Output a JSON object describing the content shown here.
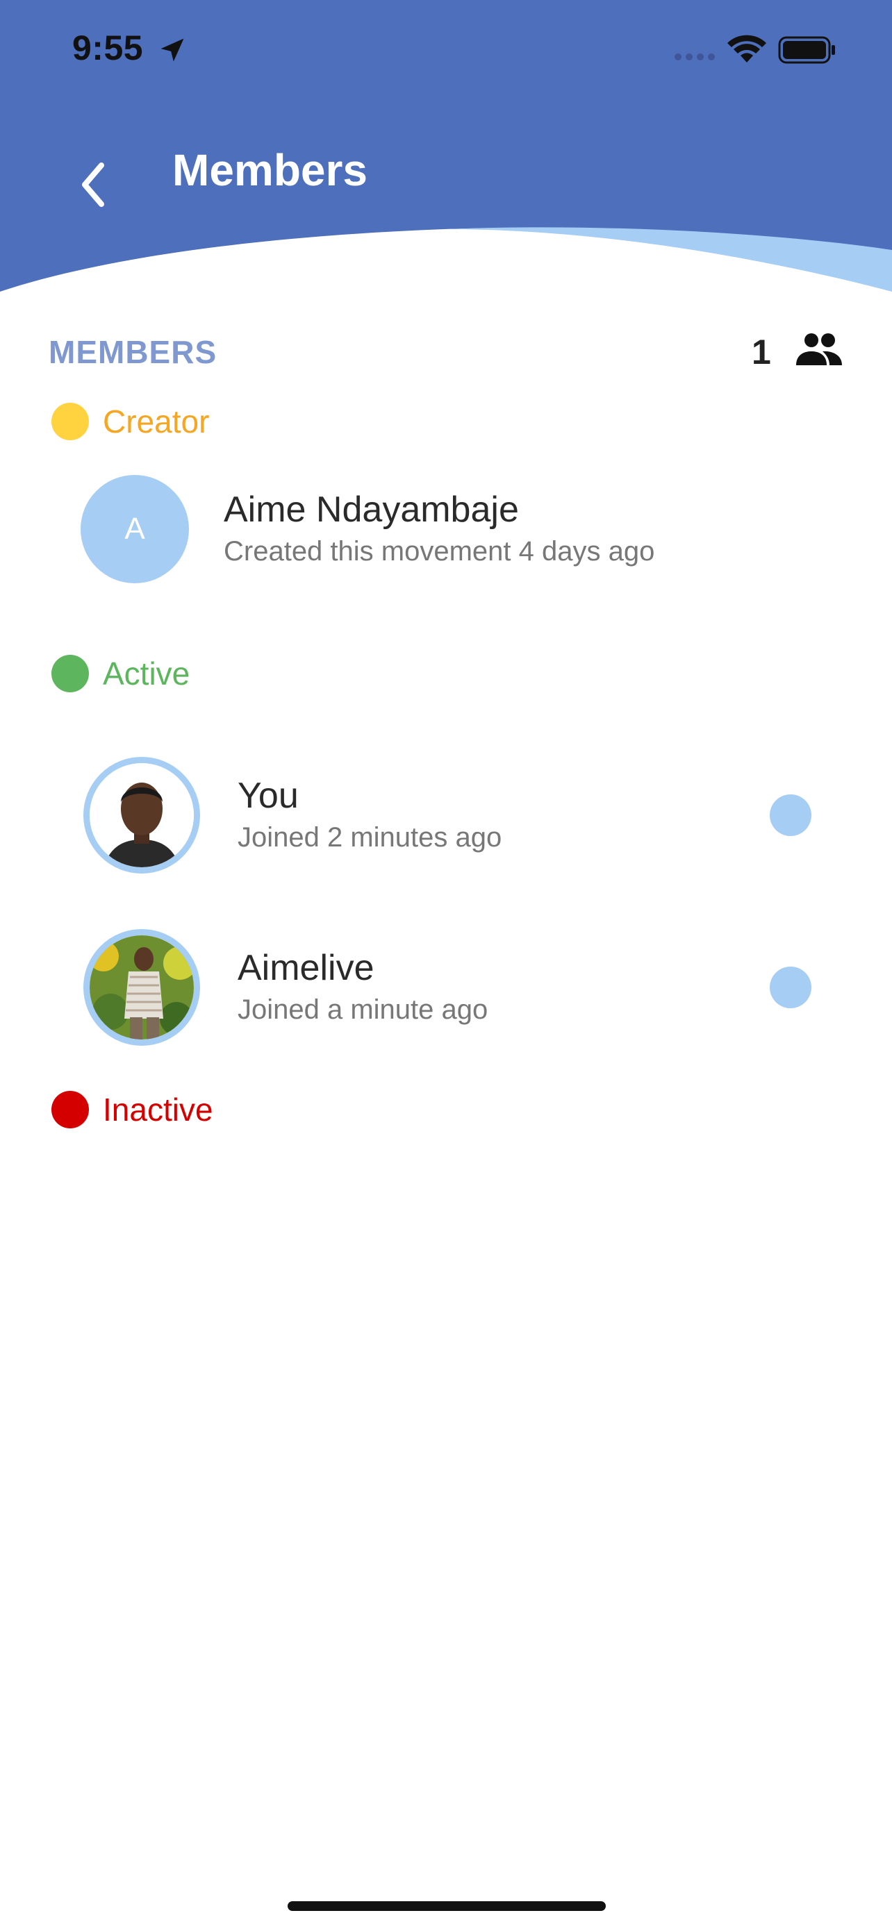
{
  "status_bar": {
    "time": "9:55"
  },
  "header": {
    "title": "Members",
    "bg_color": "#4E6FBC",
    "wave_color": "#A6CDF4"
  },
  "members_section": {
    "label": "MEMBERS",
    "count": "1"
  },
  "categories": {
    "creator": {
      "label": "Creator",
      "color": "#F5A623",
      "dot_color": "#FFD23F"
    },
    "active": {
      "label": "Active",
      "color": "#5DB55E",
      "dot_color": "#5DB55E"
    },
    "inactive": {
      "label": "Inactive",
      "color": "#D40000",
      "dot_color": "#D40000"
    }
  },
  "creator_member": {
    "initial": "A",
    "name": "Aime Ndayambaje",
    "subtitle": "Created this movement 4 days ago"
  },
  "active_members": [
    {
      "name": "You",
      "subtitle": "Joined 2 minutes ago"
    },
    {
      "name": "Aimelive",
      "subtitle": "Joined a minute ago"
    }
  ]
}
